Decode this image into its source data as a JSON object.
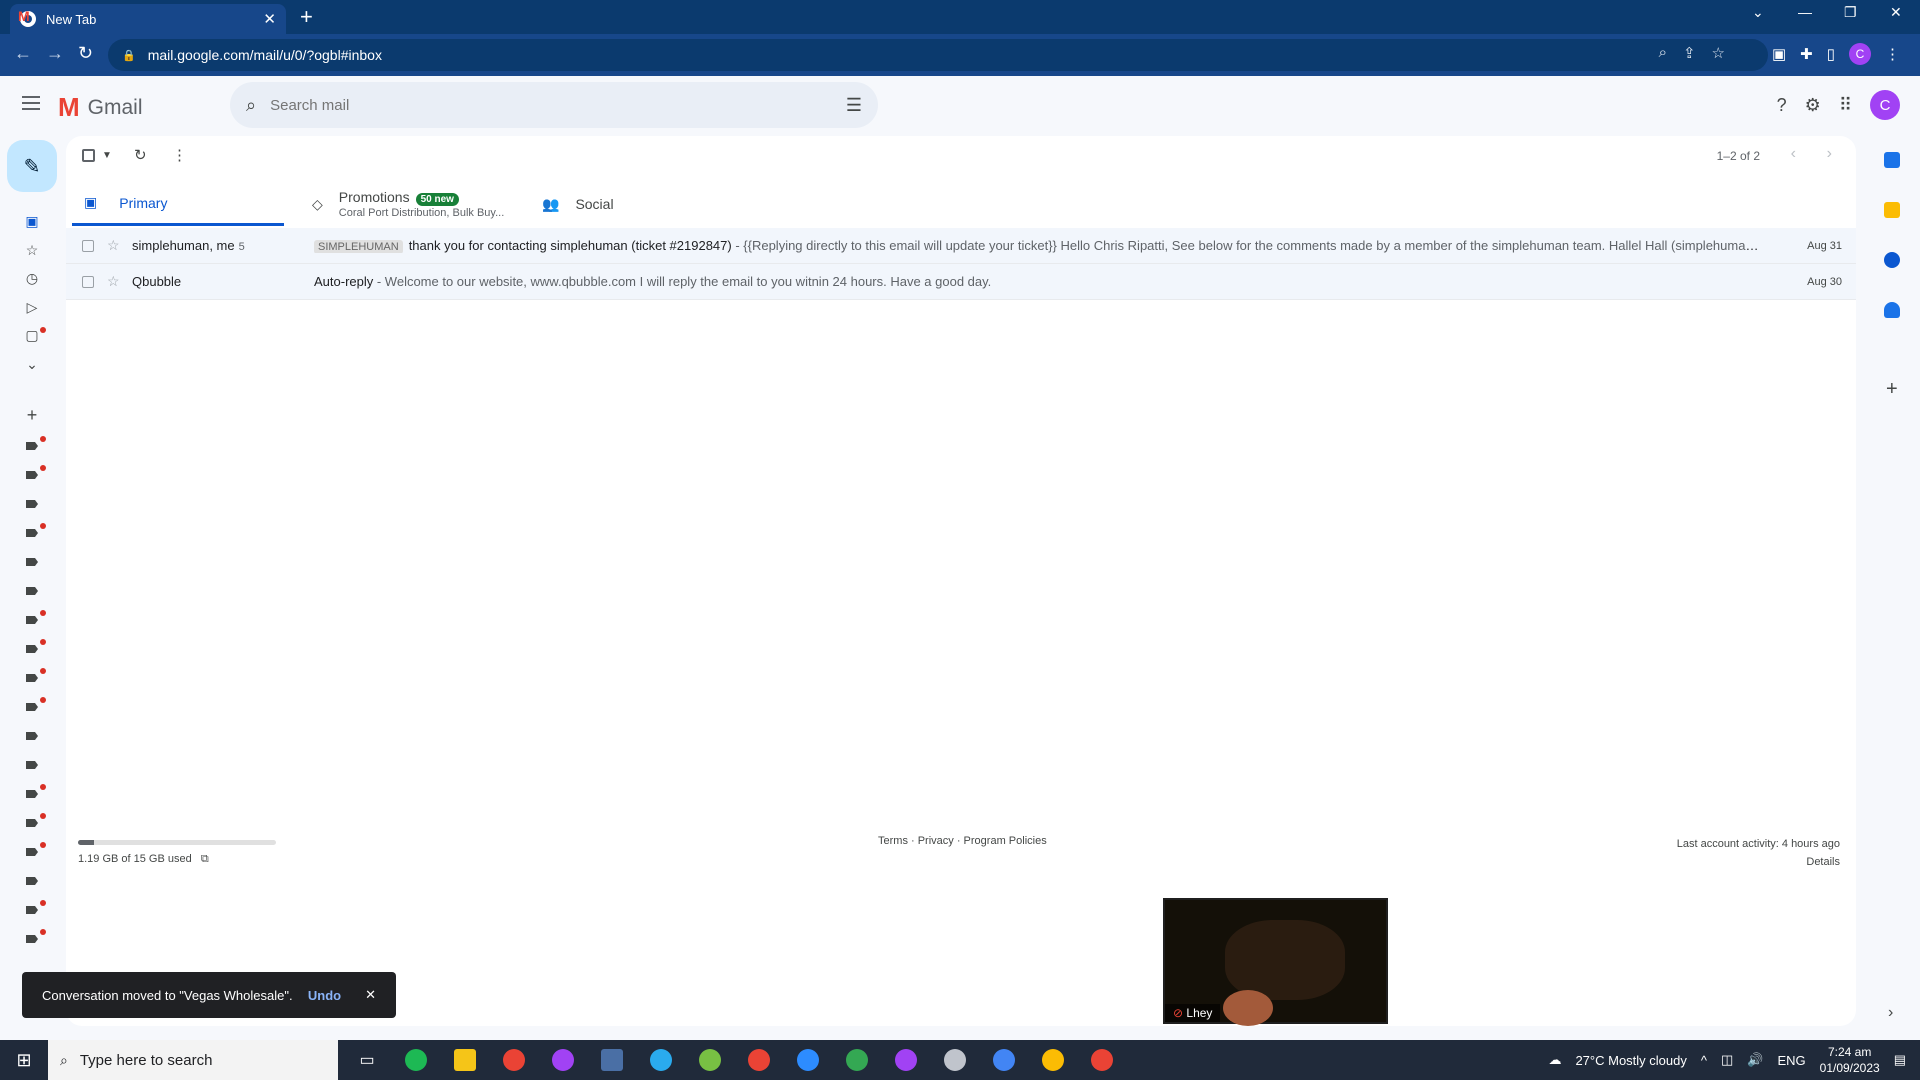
{
  "browser": {
    "tab_title": "New Tab",
    "url": "mail.google.com/mail/u/0/?ogbl#inbox",
    "profile_initial": "C"
  },
  "gmail": {
    "logo_text": "Gmail",
    "search_placeholder": "Search mail",
    "avatar_initial": "C",
    "pager_text": "1–2 of 2"
  },
  "tabs": [
    {
      "label": "Primary",
      "sub": ""
    },
    {
      "label": "Promotions",
      "sub": "Coral Port Distribution, Bulk Buy...",
      "badge": "50 new"
    },
    {
      "label": "Social",
      "sub": ""
    }
  ],
  "emails": [
    {
      "sender": "simplehuman, me",
      "count": "5",
      "label": "SIMPLEHUMAN",
      "subject": "thank you for contacting simplehuman (ticket #2192847)",
      "snippet": " - {{Replying directly to this email will update your ticket}} Hello Chris Ripatti, See below for the comments made by a member of the simplehuman team. Hallel Hall (simplehuman) A...",
      "date": "Aug 31"
    },
    {
      "sender": "Qbubble",
      "count": "",
      "label": "",
      "subject": "Auto-reply",
      "snippet": " - Welcome to our website, www.qbubble.com I will reply the email to you witnin 24 hours. Have a good day.",
      "date": "Aug 30"
    }
  ],
  "footer": {
    "storage_text": "1.19 GB of 15 GB used",
    "storage_fraction": 0.08,
    "links": "Terms · Privacy · Program Policies",
    "activity": "Last account activity: 4 hours ago",
    "details": "Details"
  },
  "snackbar": {
    "message": "Conversation moved to \"Vegas Wholesale\".",
    "undo": "Undo"
  },
  "video": {
    "name": "Lhey"
  },
  "taskbar": {
    "search_placeholder": "Type here to search",
    "weather": "27°C  Mostly cloudy",
    "lang": "ENG",
    "time": "7:24 am",
    "date": "01/09/2023"
  }
}
